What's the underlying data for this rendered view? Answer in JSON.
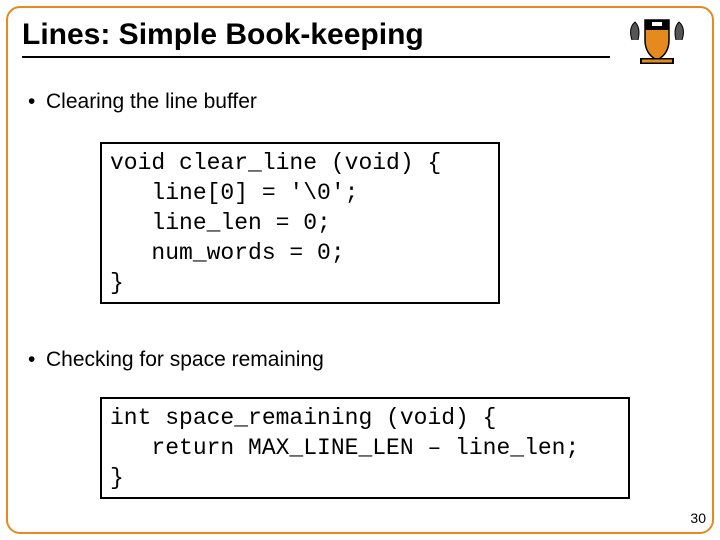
{
  "title": "Lines: Simple Book-keeping",
  "bullets": {
    "b1": "Clearing the line buffer",
    "b2": "Checking for space remaining"
  },
  "code": {
    "block1_l1": "void clear_line (void) {",
    "block1_l2": "   line[0] = '\\0';",
    "block1_l3": "   line_len = 0;",
    "block1_l4": "   num_words = 0;",
    "block1_l5": "}",
    "block2_l1": "int space_remaining (void) {",
    "block2_l2": "   return MAX_LINE_LEN – line_len;",
    "block2_l3": "}"
  },
  "page_number": "30",
  "crest_alt": "Princeton shield crest",
  "colors": {
    "frame": "#e58a1f"
  }
}
